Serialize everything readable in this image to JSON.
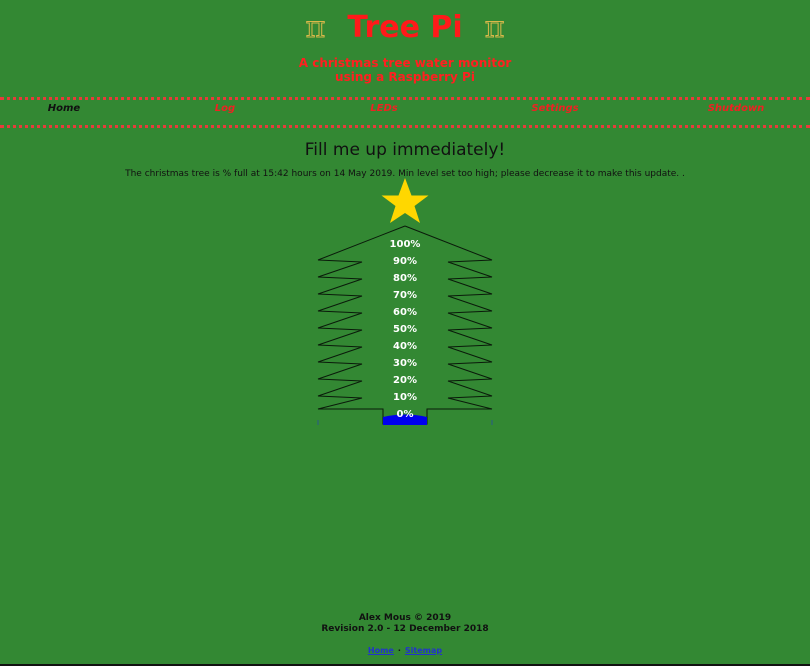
{
  "header": {
    "pi_symbol": "π",
    "title": "Tree Pi",
    "subtitle_line1": "A christmas tree water monitor",
    "subtitle_line2": "using a Raspberry Pi"
  },
  "nav": {
    "items": [
      {
        "label": "Home",
        "active": true
      },
      {
        "label": "Log",
        "active": false
      },
      {
        "label": "LEDs",
        "active": false
      },
      {
        "label": "Settings",
        "active": false
      },
      {
        "label": "Shutdown",
        "active": false
      }
    ]
  },
  "status": {
    "headline": "Fill me up immediately!",
    "message": "The christmas tree is % full at 15:42 hours on 14 May 2019. Min level set too high; please decrease it to make this update. ."
  },
  "gauge": {
    "level_labels": [
      "100%",
      "90%",
      "80%",
      "70%",
      "60%",
      "50%",
      "40%",
      "30%",
      "20%",
      "10%",
      "0%"
    ],
    "fill_color": "#0000ee",
    "star_color": "#ffd700",
    "tree_line_color": "#0a1a0a"
  },
  "footer": {
    "author": "Alex Mous © 2019",
    "revision": "Revision 2.0 - 12 December 2018",
    "link_home": "Home",
    "link_sitemap": "Sitemap",
    "separator": "·"
  },
  "colors": {
    "background": "#338833",
    "title": "#ff1a1a",
    "nav_link": "#ee2222"
  }
}
